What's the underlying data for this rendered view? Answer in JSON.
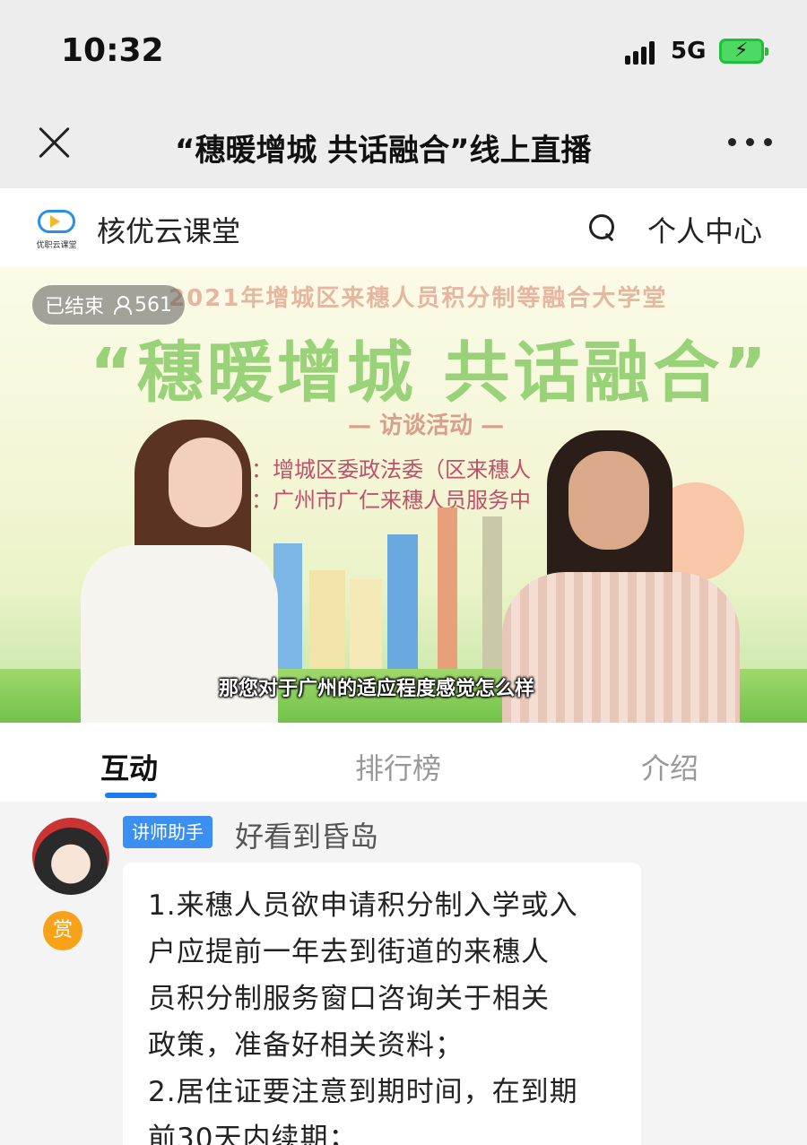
{
  "status_bar": {
    "time": "10:32",
    "network": "5G",
    "battery_icon": "battery-charging-icon",
    "signal_icon": "signal-icon"
  },
  "nav": {
    "title": "“穗暖增城 共话融合”线上直播",
    "close_icon": "close-icon",
    "more_icon": "more-icon"
  },
  "app_header": {
    "logo_text": "优职云课堂",
    "name": "核优云课堂",
    "search_icon": "search-icon",
    "personal_center": "个人中心"
  },
  "video": {
    "status_badge": "已结束",
    "viewer_count": "561",
    "banner_line1": "2021年增城区来穗人员积分制等融合大学堂",
    "banner_line2": "“穗暖增城 共话融合”",
    "banner_line3": "— 访谈活动 —",
    "organizer1": "：增城区委政法委（区来穗人　　　理局）",
    "organizer2": "：广州市广仁来穗人员服务中",
    "subtitle": "那您对于广州的适应程度感觉怎么样"
  },
  "tabs": [
    {
      "label": "互动",
      "active": true
    },
    {
      "label": "排行榜",
      "active": false
    },
    {
      "label": "介绍",
      "active": false
    }
  ],
  "chat": {
    "message": {
      "role_badge": "讲师助手",
      "username": "好看到昏岛",
      "reward_label": "赏",
      "lines": [
        "1.来穗人员欲申请积分制入学或入",
        "户应提前一年去到街道的来穗人",
        "员积分制服务窗口咨询关于相关",
        "政策，准备好相关资料；",
        "2.居住证要注意到期时间，在到期",
        "前30天内续期；"
      ]
    }
  },
  "colors": {
    "accent": "#1a7cf0",
    "badge_blue": "#3b8ff0",
    "reward_orange": "#f8a21a"
  }
}
